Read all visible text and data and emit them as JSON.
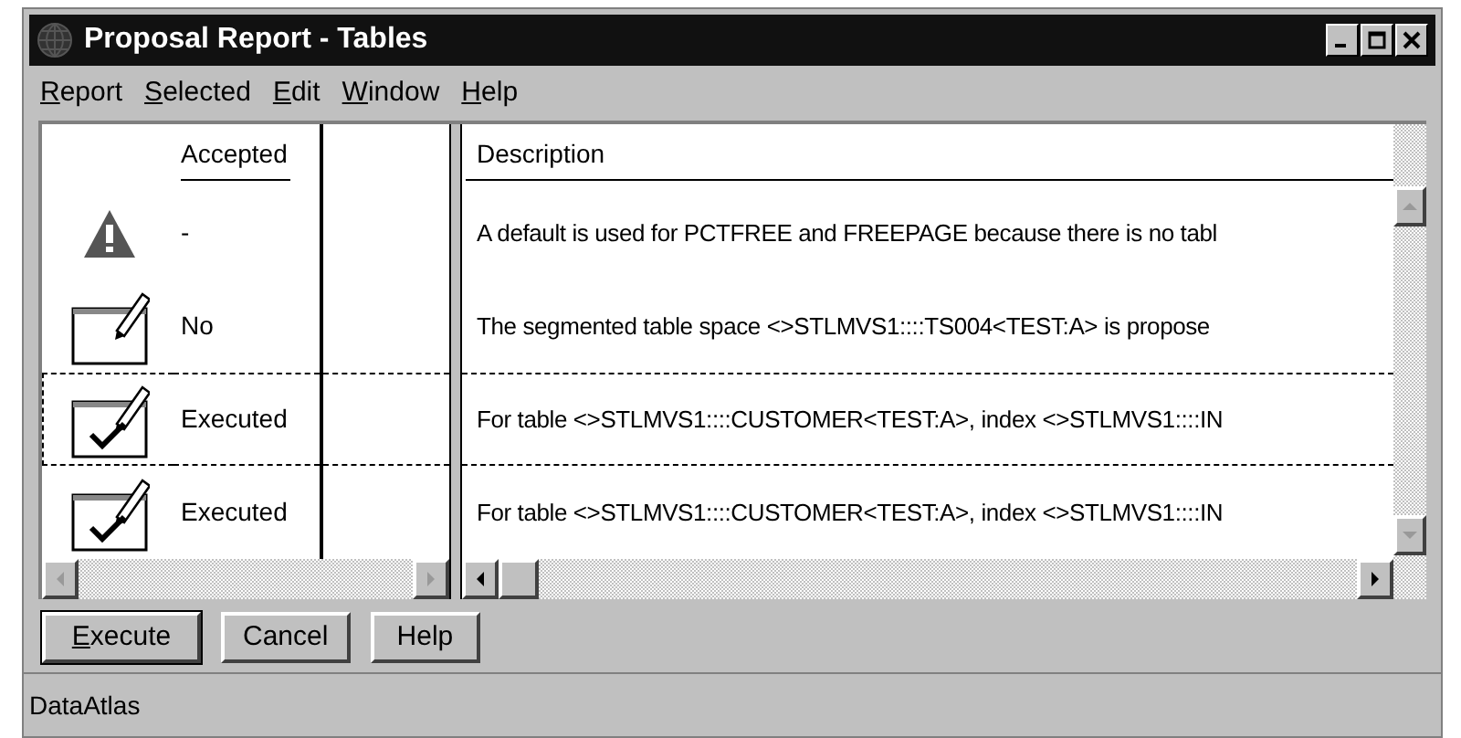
{
  "window": {
    "title": "Proposal Report - Tables"
  },
  "menu": [
    "Report",
    "Selected",
    "Edit",
    "Window",
    "Help"
  ],
  "table": {
    "columns": [
      "Accepted",
      "Description"
    ],
    "rows": [
      {
        "kind": "warning",
        "accepted": "-",
        "description": "A default is used for PCTFREE and FREEPAGE because there is no tabl",
        "focused": false
      },
      {
        "kind": "pending",
        "accepted": "No",
        "description": "The segmented table space <>STLMVS1::::TS004<TEST:A> is propose",
        "focused": false
      },
      {
        "kind": "done",
        "accepted": "Executed",
        "description": "For table <>STLMVS1::::CUSTOMER<TEST:A>, index <>STLMVS1::::IN",
        "focused": true
      },
      {
        "kind": "done",
        "accepted": "Executed",
        "description": "For table <>STLMVS1::::CUSTOMER<TEST:A>, index <>STLMVS1::::IN",
        "focused": false
      }
    ]
  },
  "buttons": [
    {
      "label": "Execute",
      "default": true
    },
    {
      "label": "Cancel",
      "default": false
    },
    {
      "label": "Help",
      "default": false
    }
  ],
  "status_bar": "DataAtlas"
}
